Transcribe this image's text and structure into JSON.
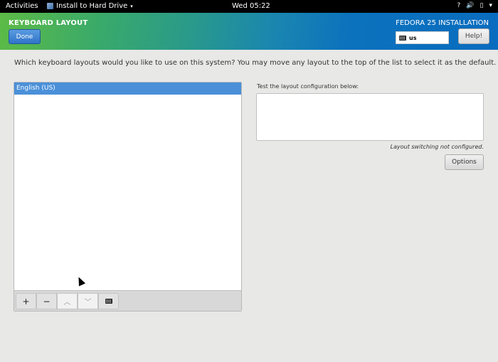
{
  "topbar": {
    "activities": "Activities",
    "app_menu": "Install to Hard Drive",
    "app_menu_caret": "▾",
    "clock": "Wed 05:22",
    "status_icons": [
      {
        "name": "network-icon",
        "glyph": "?"
      },
      {
        "name": "volume-icon",
        "glyph": "🔊"
      },
      {
        "name": "battery-icon",
        "glyph": "▯"
      },
      {
        "name": "system-menu-caret",
        "glyph": "▾"
      }
    ]
  },
  "header": {
    "title": "KEYBOARD LAYOUT",
    "done_label": "Done",
    "product": "FEDORA 25 INSTALLATION",
    "keyboard_indicator": "us",
    "help_label": "Help!"
  },
  "main": {
    "instruction": "Which keyboard layouts would you like to use on this system?  You may move any layout to the top of the list to select it as the default.",
    "layouts": [
      {
        "label": "English (US)",
        "selected": true
      }
    ],
    "toolbar": {
      "add": "+",
      "remove": "−",
      "move_up": "︿",
      "move_down": "﹀",
      "preview_icon": "keyboard-icon"
    },
    "test_label": "Test the layout configuration below:",
    "test_value": "",
    "switching_note": "Layout switching not configured.",
    "options_label": "Options"
  }
}
